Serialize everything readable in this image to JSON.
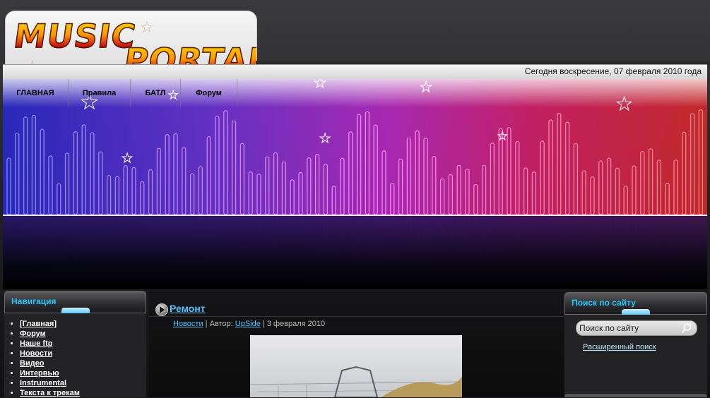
{
  "logo": {
    "line1": "MUSIC",
    "line2": "PORTAL"
  },
  "date_text": "Сегодня воскресение, 07 февраля 2010 года",
  "nav_menu": [
    {
      "label": "ГЛАВНАЯ"
    },
    {
      "label": "Правила"
    },
    {
      "label": "БАТЛ"
    },
    {
      "label": "Форум"
    }
  ],
  "left_panel": {
    "title": "Навигация",
    "items": [
      {
        "label": "[Главная]"
      },
      {
        "label": "Форум"
      },
      {
        "label": "Наше ftp"
      },
      {
        "label": "Новости"
      },
      {
        "label": "Видео"
      },
      {
        "label": "Интервью"
      },
      {
        "label": "Instrumental"
      },
      {
        "label": "Текста к трекам"
      }
    ]
  },
  "post": {
    "title": "Ремонт",
    "category": "Новости",
    "author_prefix": " | Автор: ",
    "author": "UpSide",
    "date": " | 3 февраля 2010"
  },
  "right_panel": {
    "title": "Поиск по сайту",
    "search_value": "Поиск по сайту",
    "advanced_search": "Расширенный поиск"
  },
  "colors": {
    "accent": "#25c8ff",
    "link": "#4fc3ff"
  }
}
